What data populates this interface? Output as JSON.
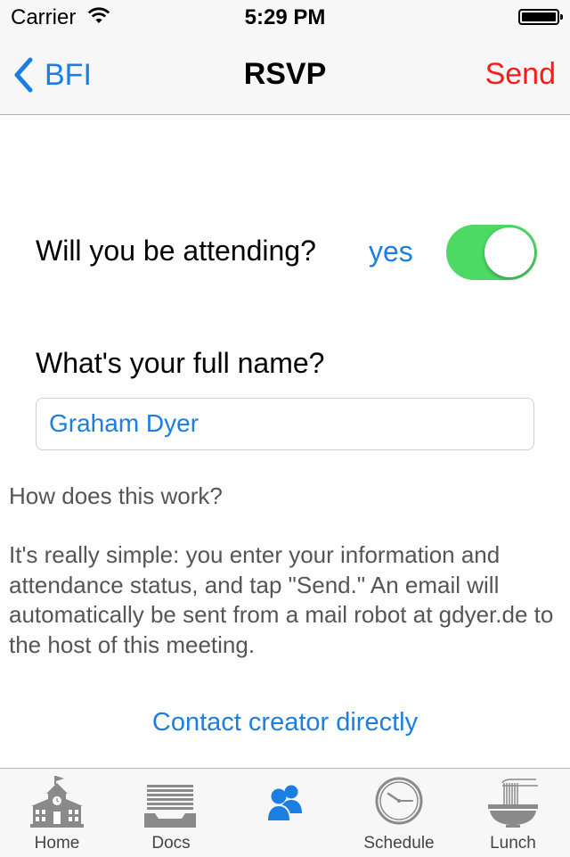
{
  "status_bar": {
    "carrier": "Carrier",
    "time": "5:29 PM"
  },
  "nav": {
    "back_label": "BFI",
    "title": "RSVP",
    "send_label": "Send"
  },
  "form": {
    "attending_question": "Will you be attending?",
    "attending_value": "yes",
    "attending_on": true,
    "name_question": "What's your full name?",
    "name_value": "Graham Dyer"
  },
  "help": {
    "heading": "How does this work?",
    "body": "It's really simple: you enter your information and attendance status, and tap \"Send.\" An email will automatically be sent from a mail robot at gdyer.de to the host of this meeting.",
    "contact_link": "Contact creator directly"
  },
  "tabs": [
    {
      "label": "Home",
      "icon": "schoolhouse-icon"
    },
    {
      "label": "Docs",
      "icon": "document-tray-icon"
    },
    {
      "label": "",
      "icon": "people-icon",
      "selected": true
    },
    {
      "label": "Schedule",
      "icon": "clock-icon"
    },
    {
      "label": "Lunch",
      "icon": "noodle-bowl-icon"
    }
  ],
  "colors": {
    "accent_blue": "#1a7ee3",
    "send_red": "#ff1a1a",
    "toggle_green": "#4cd964"
  }
}
